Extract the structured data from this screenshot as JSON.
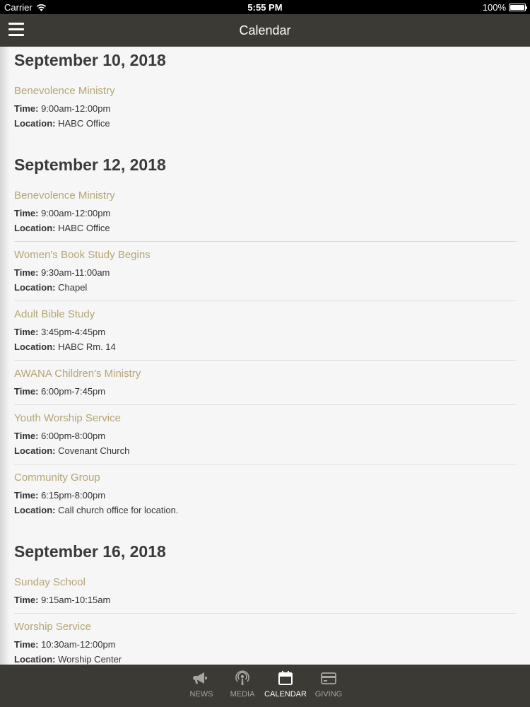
{
  "status_bar": {
    "carrier": "Carrier",
    "time": "5:55 PM",
    "battery": "100%"
  },
  "nav": {
    "title": "Calendar"
  },
  "sections": [
    {
      "date": "September 10, 2018",
      "events": [
        {
          "title": "Benevolence Ministry",
          "time": "9:00am-12:00pm",
          "location": "HABC Office"
        }
      ]
    },
    {
      "date": "September 12, 2018",
      "events": [
        {
          "title": "Benevolence Ministry",
          "time": "9:00am-12:00pm",
          "location": "HABC Office"
        },
        {
          "title": "Women's Book Study Begins",
          "time": "9:30am-11:00am",
          "location": "Chapel"
        },
        {
          "title": "Adult Bible Study",
          "time": "3:45pm-4:45pm",
          "location": "HABC Rm. 14"
        },
        {
          "title": "AWANA Children's Ministry",
          "time": "6:00pm-7:45pm"
        },
        {
          "title": "Youth Worship Service",
          "time": "6:00pm-8:00pm",
          "location": "Covenant Church"
        },
        {
          "title": "Community Group",
          "time": "6:15pm-8:00pm",
          "location": "Call church office for location."
        }
      ]
    },
    {
      "date": "September 16, 2018",
      "events": [
        {
          "title": "Sunday School",
          "time": "9:15am-10:15am"
        },
        {
          "title": "Worship Service",
          "time": "10:30am-12:00pm",
          "location": "Worship Center"
        }
      ]
    }
  ],
  "labels": {
    "time": "Time:",
    "location": "Location:"
  },
  "tabs": [
    {
      "label": "NEWS",
      "icon": "megaphone-icon"
    },
    {
      "label": "MEDIA",
      "icon": "podcast-icon"
    },
    {
      "label": "CALENDAR",
      "icon": "calendar-icon",
      "active": true
    },
    {
      "label": "GIVING",
      "icon": "credit-card-icon"
    }
  ],
  "colors": {
    "bar": "#3c3a35",
    "accent": "#b5a573",
    "background": "#f6f6f6"
  }
}
